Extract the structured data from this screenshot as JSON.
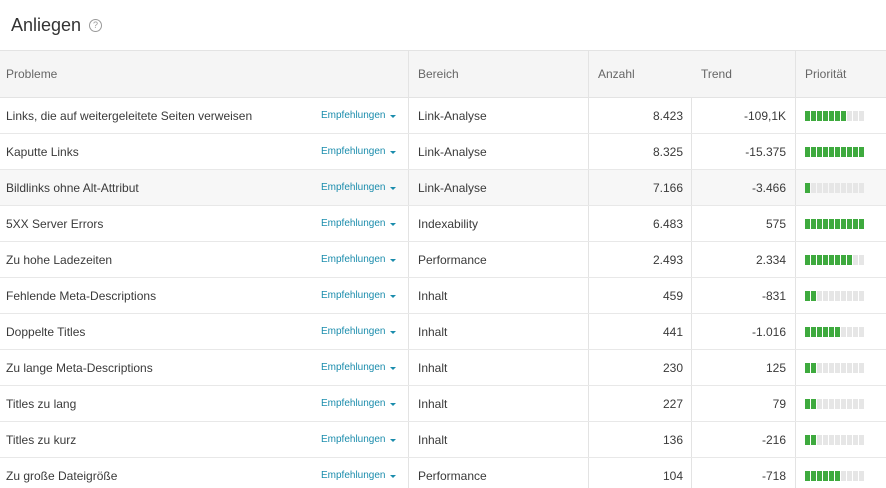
{
  "page": {
    "title": "Anliegen",
    "help_icon": "help-circle-icon"
  },
  "colors": {
    "priority_fill": "#3eaa3e",
    "priority_empty": "#e6e6e6",
    "link": "#1a8cac"
  },
  "table": {
    "headers": {
      "problem": "Probleme",
      "area": "Bereich",
      "count": "Anzahl",
      "trend": "Trend",
      "priority": "Priorität"
    },
    "recommendation_label": "Empfehlungen",
    "priority_max": 10,
    "rows": [
      {
        "problem": "Links, die auf weitergeleitete Seiten verweisen",
        "area": "Link-Analyse",
        "count": "8.423",
        "trend": "-109,1K",
        "priority": 7
      },
      {
        "problem": "Kaputte Links",
        "area": "Link-Analyse",
        "count": "8.325",
        "trend": "-15.375",
        "priority": 10
      },
      {
        "problem": "Bildlinks ohne Alt-Attribut",
        "area": "Link-Analyse",
        "count": "7.166",
        "trend": "-3.466",
        "priority": 1
      },
      {
        "problem": "5XX Server Errors",
        "area": "Indexability",
        "count": "6.483",
        "trend": "575",
        "priority": 10
      },
      {
        "problem": "Zu hohe Ladezeiten",
        "area": "Performance",
        "count": "2.493",
        "trend": "2.334",
        "priority": 8
      },
      {
        "problem": "Fehlende Meta-Descriptions",
        "area": "Inhalt",
        "count": "459",
        "trend": "-831",
        "priority": 2
      },
      {
        "problem": "Doppelte Titles",
        "area": "Inhalt",
        "count": "441",
        "trend": "-1.016",
        "priority": 6
      },
      {
        "problem": "Zu lange Meta-Descriptions",
        "area": "Inhalt",
        "count": "230",
        "trend": "125",
        "priority": 2
      },
      {
        "problem": "Titles zu lang",
        "area": "Inhalt",
        "count": "227",
        "trend": "79",
        "priority": 2
      },
      {
        "problem": "Titles zu kurz",
        "area": "Inhalt",
        "count": "136",
        "trend": "-216",
        "priority": 2
      },
      {
        "problem": "Zu große Dateigröße",
        "area": "Performance",
        "count": "104",
        "trend": "-718",
        "priority": 6
      }
    ]
  }
}
